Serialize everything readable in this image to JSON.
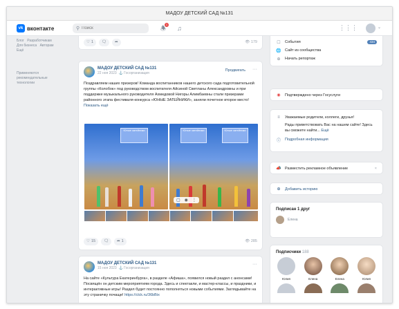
{
  "window": {
    "title": "МАДОУ ДЕТСКИЙ САД №131"
  },
  "header": {
    "logo_text": "вконтакте",
    "logo_mark": "vk",
    "search_placeholder": "Поиск",
    "notifications_count": "1",
    "icons": [
      "bell-icon",
      "music-icon",
      "apps-grid-icon",
      "avatar",
      "chevron-down-icon"
    ]
  },
  "leftnav": {
    "links": [
      "Блог",
      "Разработчикам",
      "Для бизнеса",
      "Авторам",
      "Ещё"
    ],
    "caption": "Применяются рекомендательные технологии"
  },
  "prev_post": {
    "likes": "1",
    "views": "179"
  },
  "post1": {
    "author": "МАДОУ ДЕТСКИЙ САД №131",
    "date": "22 ноя 2023",
    "source": "Госорганизация",
    "promote": "Продвигать",
    "text": "Поздравляем наших призеров! Команда воспитанников нашего детского сада подготовительной группы «Колобок» под руководством воспитателя Айсиной Светланы Александровны и при поддержке музыкального руководителя Ахмедовой Нигоры Алимбаевны стали призерами районного этапа фестиваля-конкурса «ЮНЫЕ ЗАТЕЙНИКИ», заняли почетное второе место!",
    "more": "Показать ещё",
    "screen_caption": "Юные затейники",
    "likes": "15",
    "reposts": "1",
    "views": "285"
  },
  "post2": {
    "author": "МАДОУ ДЕТСКИЙ САД №131",
    "date": "15 ноя 2023",
    "source": "Госорганизация",
    "text": "На сайте «Культура Екатеринбурга», в разделе «Афиша», появился новый раздел с анонсами! Посвящён он детским мероприятиям города. Здесь и спектакли, и мастер-классы, и праздники, и интерактивные игры! Раздел будет постоянно пополняться новыми событиями. Заглядывайте на эту страничку почаще!",
    "link": "https://clck.ru/36bBix"
  },
  "side": {
    "events_label": "События",
    "events_count": "434",
    "site_label": "Сайт из сообщества",
    "report_label": "Начать репортаж",
    "gosuslugi": "Подтверждено через Госуслуги",
    "about_text": "Уважаемые родители, коллеги, друзья!",
    "about_text2": "Рады приветствовать Вас на нашем сайте! Здесь вы сможете найти...",
    "about_more": "Ещё",
    "details": "Подробная информация",
    "ad_label": "Разместить рекламное объявление",
    "story_label": "Добавить историю",
    "friends_title": "Подписан 1 друг",
    "friend_name": "Елена",
    "subscribers_title": "Подписчики",
    "subscribers_count": "188",
    "subscribers": [
      "Юлия",
      "Елена",
      "Елена",
      "Юлия"
    ]
  }
}
